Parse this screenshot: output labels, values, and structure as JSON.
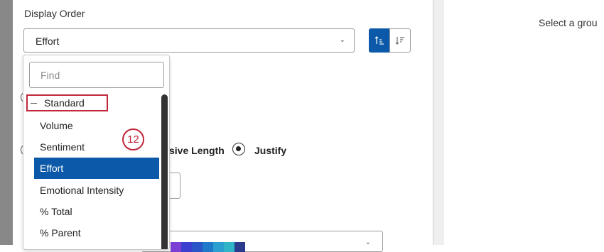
{
  "display_order": {
    "label": "Display Order",
    "selected": "Effort",
    "sort_asc_icon": "sort-ascending-icon",
    "sort_desc_icon": "sort-descending-icon"
  },
  "dropdown": {
    "find_placeholder": "Find",
    "group": "Standard",
    "options": [
      "Volume",
      "Sentiment",
      "Effort",
      "Emotional Intensity",
      "% Total",
      "% Parent"
    ],
    "selected_index": 2
  },
  "background": {
    "length_label": "sive Length",
    "justify_label": "Justify"
  },
  "right_panel": {
    "text": "Select a grou"
  },
  "annotation": {
    "number": "12"
  },
  "colors": {
    "accent": "#0b59a8",
    "highlight": "#c0283a",
    "swatches": [
      "#7b3fd6",
      "#3b3fd0",
      "#2a55c8",
      "#1f78c9",
      "#2a9fd0",
      "#2fb5c7",
      "#2a3a8c"
    ]
  }
}
